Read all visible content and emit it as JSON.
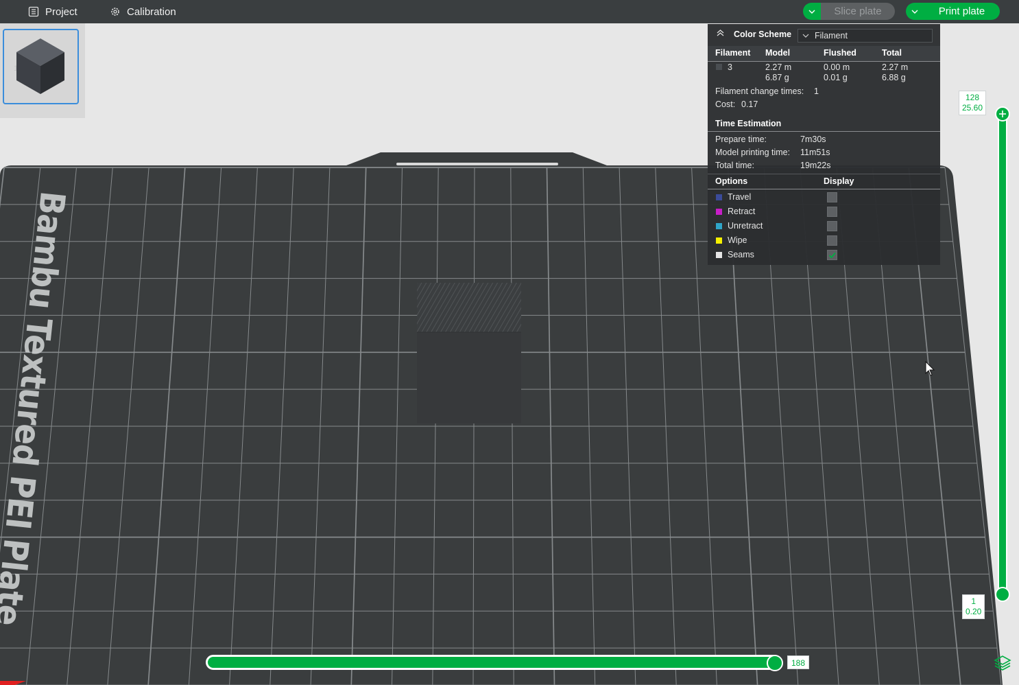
{
  "topbar": {
    "project_label": "Project",
    "calibration_label": "Calibration",
    "slice_label": "Slice plate",
    "print_label": "Print plate"
  },
  "plate_list": {
    "selected_number": "1"
  },
  "bed": {
    "label": "Bambu Textured PEI Plate"
  },
  "legend": {
    "color_scheme_label": "Color Scheme",
    "color_scheme_value": "Filament",
    "columns": {
      "filament": "Filament",
      "model": "Model",
      "flushed": "Flushed",
      "total": "Total"
    },
    "filament_row": {
      "id": "3",
      "color": "#4a4e52",
      "model_length": "2.27 m",
      "model_weight": "6.87 g",
      "flushed_length": "0.00 m",
      "flushed_weight": "0.01 g",
      "total_length": "2.27 m",
      "total_weight": "6.88 g"
    },
    "filament_change_label": "Filament change times:",
    "filament_change_value": "1",
    "cost_label": "Cost:",
    "cost_value": "0.17",
    "time_header": "Time Estimation",
    "prepare_label": "Prepare time:",
    "prepare_value": "7m30s",
    "model_time_label": "Model printing time:",
    "model_time_value": "11m51s",
    "total_time_label": "Total time:",
    "total_time_value": "19m22s",
    "options_header": "Options",
    "display_header": "Display",
    "options": [
      {
        "label": "Travel",
        "color": "#3b4b9a",
        "checked": false
      },
      {
        "label": "Retract",
        "color": "#c81ec8",
        "checked": false
      },
      {
        "label": "Unretract",
        "color": "#2fa5c8",
        "checked": false
      },
      {
        "label": "Wipe",
        "color": "#f5f000",
        "checked": false
      },
      {
        "label": "Seams",
        "color": "#e6e6e6",
        "checked": true
      }
    ]
  },
  "layer_slider": {
    "top_layer": "128",
    "top_height": "25.60",
    "bottom_layer": "1",
    "bottom_height": "0.20"
  },
  "move_slider": {
    "value": "188"
  },
  "colors": {
    "accent": "#00ae42",
    "bed": "#3a3d3e",
    "grid": "#8a8d8f"
  }
}
